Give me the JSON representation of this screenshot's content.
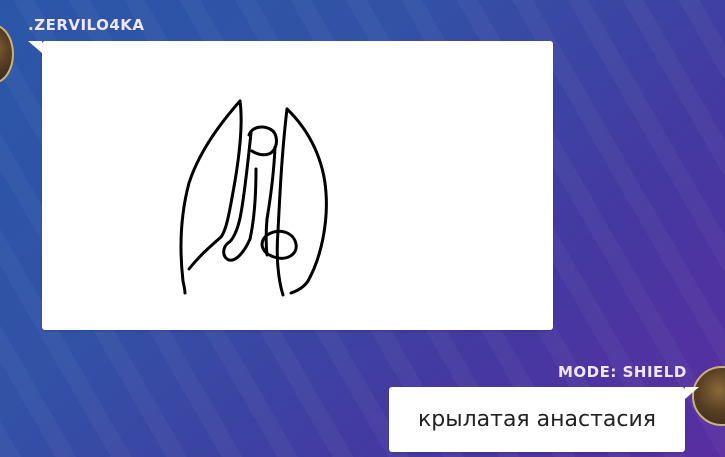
{
  "messages": [
    {
      "username": ".ZERVILO4KA",
      "type": "drawing"
    },
    {
      "username": "MODE: SHIELD",
      "text": "крылатая анастасия"
    }
  ],
  "colors": {
    "background_start": "#2b56a8",
    "background_end": "#5a2ea0",
    "username": "#f1e6ff",
    "bubble": "#ffffff",
    "ink": "#000000"
  }
}
